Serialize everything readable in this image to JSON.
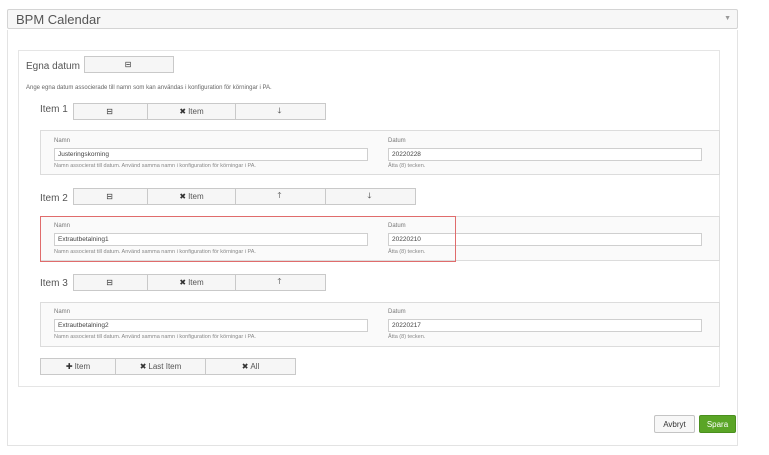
{
  "header": {
    "title": "BPM Calendar"
  },
  "section": {
    "label": "Egna datum",
    "description": "Ange egna datum associerade till namn som kan användas i konfiguration för körningar i PA."
  },
  "item_buttons": {
    "remove_item": "Item"
  },
  "items": [
    {
      "title": "Item 1",
      "name_label": "Namn",
      "name_value": "Justeringskorning",
      "name_help": "Namn associerat till datum. Använd samma namn i konfiguration för körningar i PA.",
      "date_label": "Datum",
      "date_value": "20220228",
      "date_help": "Åtta (8) tecken."
    },
    {
      "title": "Item 2",
      "name_label": "Namn",
      "name_value": "Extrautbetalning1",
      "name_help": "Namn associerat till datum. Använd samma namn i konfiguration för körningar i PA.",
      "date_label": "Datum",
      "date_value": "20220210",
      "date_help": "Åtta (8) tecken."
    },
    {
      "title": "Item 3",
      "name_label": "Namn",
      "name_value": "Extrautbetalning2",
      "name_help": "Namn associerat till datum. Använd samma namn i konfiguration för körningar i PA.",
      "date_label": "Datum",
      "date_value": "20220217",
      "date_help": "Åtta (8) tecken."
    }
  ],
  "bottom_buttons": {
    "add_item": "Item",
    "remove_last": "Last Item",
    "remove_all": "All"
  },
  "footer": {
    "cancel": "Avbryt",
    "save": "Spara"
  },
  "colors": {
    "save": "#5aa526",
    "highlight": "#e06c6c"
  }
}
